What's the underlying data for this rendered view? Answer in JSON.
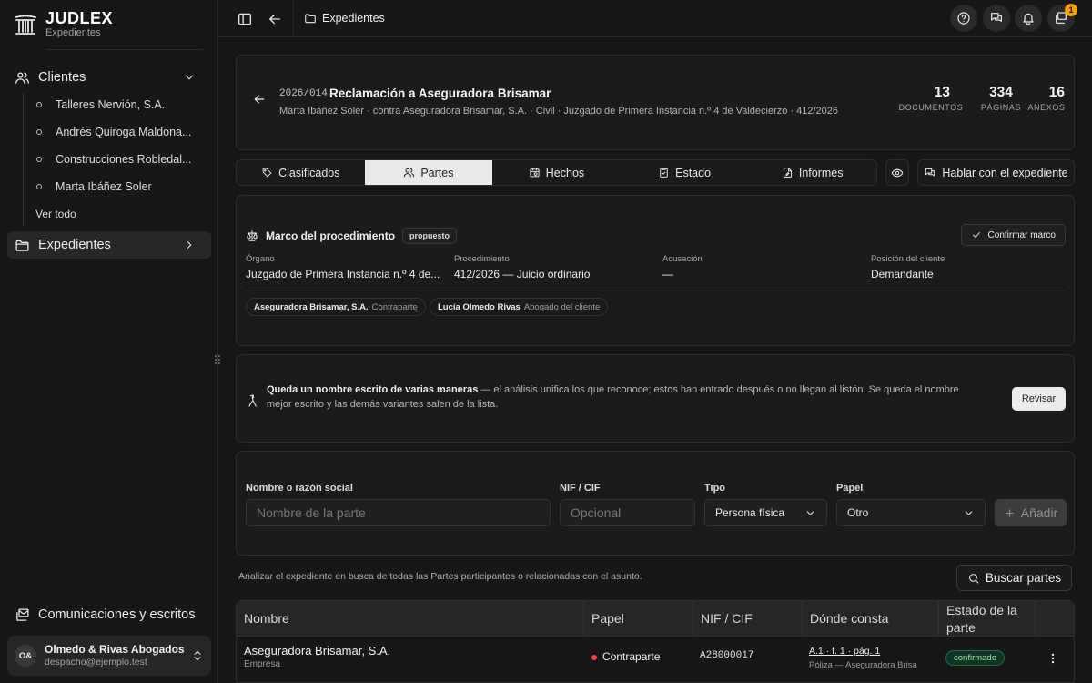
{
  "brand": {
    "name": "JUDLEX",
    "subtitle": "Expedientes"
  },
  "sidebar": {
    "clientes_label": "Clientes",
    "clients": [
      "Talleres Nervión, S.A.",
      "Andrés Quiroga Maldona...",
      "Construcciones Robledal...",
      "Marta Ibáñez Soler"
    ],
    "see_all": "Ver todo",
    "expedientes_label": "Expedientes",
    "comms_label": "Comunicaciones y escritos",
    "account": {
      "initials": "O&",
      "name": "Olmedo & Rivas Abogados",
      "email": "despacho@ejemplo.test"
    }
  },
  "topbar": {
    "breadcrumb": "Expedientes",
    "notification_count": "1"
  },
  "case": {
    "code": "2026/014",
    "title": "Reclamación a Aseguradora Brisamar",
    "meta": "Marta Ibáñez Soler · contra Aseguradora Brisamar, S.A. · Civil · Juzgado de Primera Instancia n.º 4 de Valdecierzo · 412/2026",
    "stats": [
      {
        "value": "13",
        "label": "DOCUMENTOS"
      },
      {
        "value": "334",
        "label": "PÁGINAS"
      },
      {
        "value": "16",
        "label": "ANEXOS"
      }
    ]
  },
  "tabs": [
    "Clasificados",
    "Partes",
    "Hechos",
    "Estado",
    "Informes"
  ],
  "active_tab": "Partes",
  "chat_button": "Hablar con el expediente",
  "marco": {
    "title": "Marco del procedimiento",
    "badge": "propuesto",
    "confirm": "Confirmar marco",
    "fields": [
      {
        "label": "Órgano",
        "value": "Juzgado de Primera Instancia n.º 4 de..."
      },
      {
        "label": "Procedimiento",
        "value": "412/2026 — Juicio ordinario"
      },
      {
        "label": "Acusación",
        "value": "—"
      },
      {
        "label": "Posición del cliente",
        "value": "Demandante"
      }
    ],
    "chips": [
      {
        "name": "Aseguradora Brisamar, S.A.",
        "role": "Contraparte"
      },
      {
        "name": "Lucía Olmedo Rivas",
        "role": "Abogado del cliente"
      }
    ]
  },
  "notice": {
    "bold": "Queda un nombre escrito de varias maneras",
    "text": " — el análisis unifica los que reconoce; estos han entrado después o no llegan al listón. Se queda el nombre mejor escrito y las demás variantes salen de la lista.",
    "button": "Revisar"
  },
  "form": {
    "name_label": "Nombre o razón social",
    "name_placeholder": "Nombre de la parte",
    "nif_label": "NIF / CIF",
    "nif_placeholder": "Opcional",
    "tipo_label": "Tipo",
    "tipo_value": "Persona física",
    "papel_label": "Papel",
    "papel_value": "Otro",
    "add_button": "Añadir"
  },
  "analyze_text": "Analizar el expediente en busca de todas las Partes participantes o relacionadas con el asunto.",
  "search_button": "Buscar partes",
  "table": {
    "headers": [
      "Nombre",
      "Papel",
      "NIF / CIF",
      "Dónde consta",
      "Estado de la parte"
    ],
    "rows": [
      {
        "name": "Aseguradora Brisamar, S.A.",
        "type": "Empresa",
        "role": "Contraparte",
        "nif": "A28000017",
        "where": "A.1 · f. 1 · pág. 1",
        "where_sub": "Póliza — Aseguradora Brisa",
        "status": "confirmado"
      }
    ]
  },
  "colors": {
    "accent_status": "#1c6e44",
    "badge": "#f59e0b",
    "role_dot": "#ef4444"
  }
}
